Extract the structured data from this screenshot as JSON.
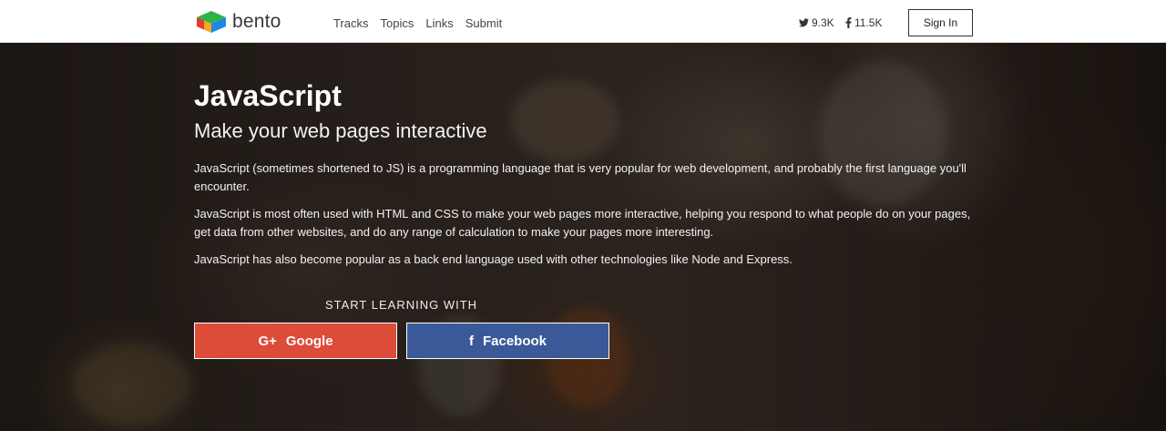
{
  "brand": {
    "name": "bento",
    "logo_icon": "bento-cube-icon"
  },
  "nav": {
    "items": [
      "Tracks",
      "Topics",
      "Links",
      "Submit"
    ]
  },
  "social": {
    "twitter": {
      "icon": "twitter-icon",
      "count": "9.3K"
    },
    "facebook": {
      "icon": "facebook-icon",
      "count": "11.5K"
    }
  },
  "auth": {
    "signin_label": "Sign In"
  },
  "hero": {
    "title": "JavaScript",
    "subtitle": "Make your web pages interactive",
    "paragraphs": [
      "JavaScript (sometimes shortened to JS) is a programming language that is very popular for web development, and probably the first language you'll encounter.",
      "JavaScript is most often used with HTML and CSS to make your web pages more interactive, helping you respond to what people do on your pages, get data from other websites, and do any range of calculation to make your pages more interesting.",
      "JavaScript has also become popular as a back end language used with other technologies like Node and Express."
    ],
    "start_label": "START LEARNING WITH",
    "buttons": [
      {
        "label": "Google",
        "icon": "google-plus-icon",
        "glyph": "G+",
        "color": "#dd4b39"
      },
      {
        "label": "Facebook",
        "icon": "facebook-icon",
        "glyph": "f",
        "color": "#3b5998"
      }
    ]
  }
}
